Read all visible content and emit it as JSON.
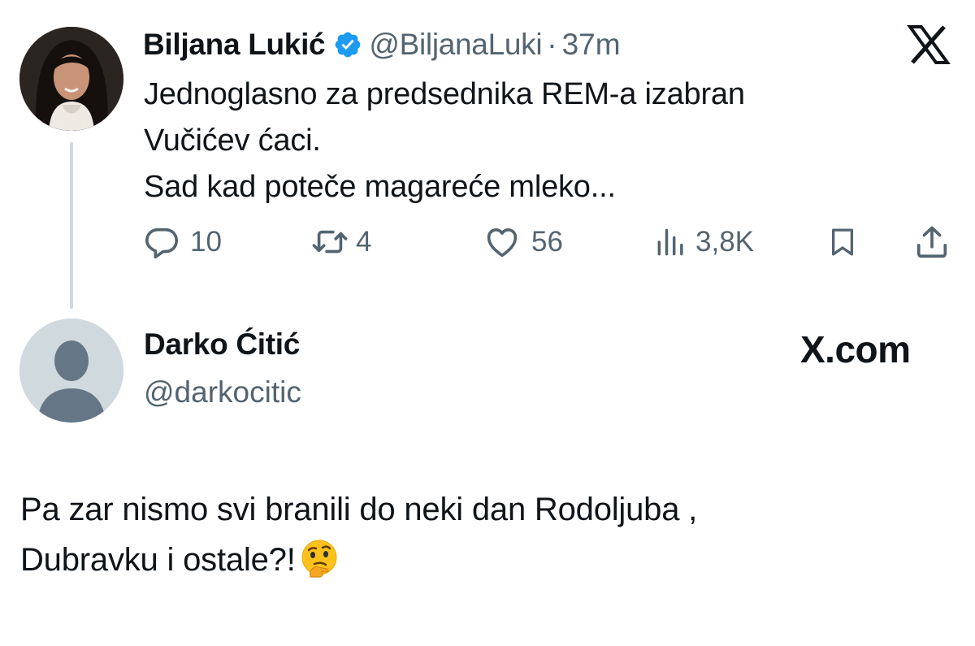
{
  "quoted_tweet": {
    "author_name": "Biljana Lukić",
    "handle": "@BiljanaLuki",
    "separator": "·",
    "time": "37m",
    "text_lines": [
      "Jednoglasno za predsednika REM-a izabran",
      "Vučićev ćaci.",
      "Sad kad poteče magareće mleko..."
    ],
    "stats": {
      "replies": "10",
      "reposts": "4",
      "likes": "56",
      "views": "3,8K"
    },
    "icons": [
      "verified-badge-icon",
      "x-logo-icon",
      "reply-icon",
      "repost-icon",
      "like-icon",
      "views-icon",
      "bookmark-icon",
      "share-icon"
    ]
  },
  "reply_tweet": {
    "author_name": "Darko Ćitić",
    "handle": "@darkocitic",
    "watermark": "X.com",
    "text_lines": [
      "Pa zar nismo svi branili do neki dan Rodoljuba ,",
      "Dubravku i ostale?!"
    ],
    "emoji": "thinking-face-emoji"
  },
  "colors": {
    "text": "#0f1419",
    "secondary": "#536471",
    "verified": "#1d9bf0",
    "thread_line": "#cfd9de",
    "default_avatar_bg": "#cfd9de",
    "default_avatar_fg": "#657786"
  }
}
